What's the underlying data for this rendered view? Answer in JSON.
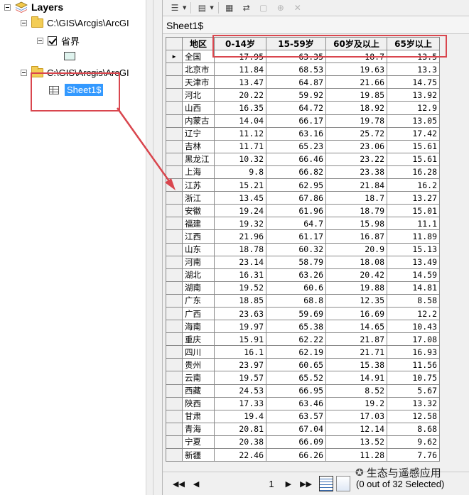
{
  "toc": {
    "root_label": "Layers",
    "folder1_label": "C:\\GIS\\Arcgis\\ArcGI",
    "layer_label": "省界",
    "folder2_label": "C:\\GIS\\Arcgis\\ArcGI",
    "table_label": "Sheet1$"
  },
  "table_window": {
    "tab_title": "Sheet1$",
    "columns": [
      "地区",
      "0-14岁",
      "15-59岁",
      "60岁及以上",
      "65岁以上"
    ],
    "rows": [
      [
        "全国",
        "17.95",
        "63.35",
        "18.7",
        "13.5"
      ],
      [
        "北京市",
        "11.84",
        "68.53",
        "19.63",
        "13.3"
      ],
      [
        "天津市",
        "13.47",
        "64.87",
        "21.66",
        "14.75"
      ],
      [
        "河北",
        "20.22",
        "59.92",
        "19.85",
        "13.92"
      ],
      [
        "山西",
        "16.35",
        "64.72",
        "18.92",
        "12.9"
      ],
      [
        "内蒙古",
        "14.04",
        "66.17",
        "19.78",
        "13.05"
      ],
      [
        "辽宁",
        "11.12",
        "63.16",
        "25.72",
        "17.42"
      ],
      [
        "吉林",
        "11.71",
        "65.23",
        "23.06",
        "15.61"
      ],
      [
        "黑龙江",
        "10.32",
        "66.46",
        "23.22",
        "15.61"
      ],
      [
        "上海",
        "9.8",
        "66.82",
        "23.38",
        "16.28"
      ],
      [
        "江苏",
        "15.21",
        "62.95",
        "21.84",
        "16.2"
      ],
      [
        "浙江",
        "13.45",
        "67.86",
        "18.7",
        "13.27"
      ],
      [
        "安徽",
        "19.24",
        "61.96",
        "18.79",
        "15.01"
      ],
      [
        "福建",
        "19.32",
        "64.7",
        "15.98",
        "11.1"
      ],
      [
        "江西",
        "21.96",
        "61.17",
        "16.87",
        "11.89"
      ],
      [
        "山东",
        "18.78",
        "60.32",
        "20.9",
        "15.13"
      ],
      [
        "河南",
        "23.14",
        "58.79",
        "18.08",
        "13.49"
      ],
      [
        "湖北",
        "16.31",
        "63.26",
        "20.42",
        "14.59"
      ],
      [
        "湖南",
        "19.52",
        "60.6",
        "19.88",
        "14.81"
      ],
      [
        "广东",
        "18.85",
        "68.8",
        "12.35",
        "8.58"
      ],
      [
        "广西",
        "23.63",
        "59.69",
        "16.69",
        "12.2"
      ],
      [
        "海南",
        "19.97",
        "65.38",
        "14.65",
        "10.43"
      ],
      [
        "重庆",
        "15.91",
        "62.22",
        "21.87",
        "17.08"
      ],
      [
        "四川",
        "16.1",
        "62.19",
        "21.71",
        "16.93"
      ],
      [
        "贵州",
        "23.97",
        "60.65",
        "15.38",
        "11.56"
      ],
      [
        "云南",
        "19.57",
        "65.52",
        "14.91",
        "10.75"
      ],
      [
        "西藏",
        "24.53",
        "66.95",
        "8.52",
        "5.67"
      ],
      [
        "陕西",
        "17.33",
        "63.46",
        "19.2",
        "13.32"
      ],
      [
        "甘肃",
        "19.4",
        "63.57",
        "17.03",
        "12.58"
      ],
      [
        "青海",
        "20.81",
        "67.04",
        "12.14",
        "8.68"
      ],
      [
        "宁夏",
        "20.38",
        "66.09",
        "13.52",
        "9.62"
      ],
      [
        "新疆",
        "22.46",
        "66.26",
        "11.28",
        "7.76"
      ]
    ],
    "current_row_marker": "▶",
    "page_number": "1",
    "selection_status": "(0 out of 32 Selected)"
  },
  "watermark": "生态与遥感应用",
  "colors": {
    "highlight": "#d9464e",
    "selection": "#3399ff",
    "folder": "#f3cd56"
  }
}
